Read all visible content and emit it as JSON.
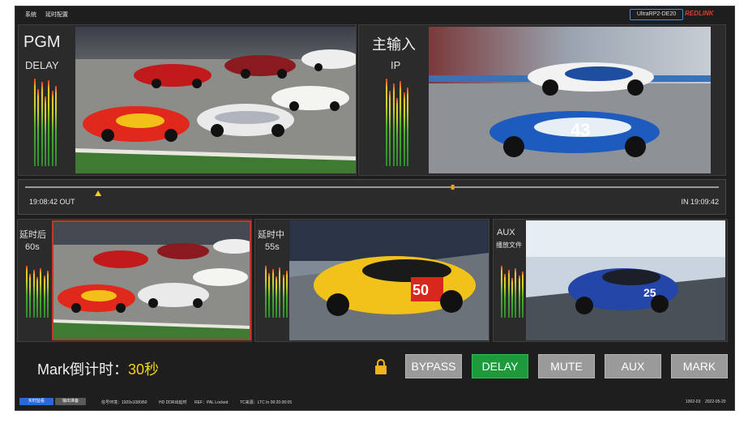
{
  "menu": {
    "system": "系统",
    "delay_config": "延时配置"
  },
  "device": {
    "model": "UltraRP2-DE20",
    "brand": "REDLINK"
  },
  "pgm": {
    "title": "PGM",
    "subtitle": "DELAY"
  },
  "input": {
    "title": "主输入",
    "subtitle": "IP"
  },
  "timeline": {
    "out_time": "19:08:42 OUT",
    "in_time": "IN 19:09:42",
    "out_marker_fraction": 0.105,
    "playhead_fraction": 0.615
  },
  "previews": [
    {
      "title": "延时后",
      "sub": "60s"
    },
    {
      "title": "延时中",
      "sub": "55s"
    },
    {
      "title": "AUX",
      "sub": "播放文件"
    }
  ],
  "mark": {
    "label": "Mark倒计时：",
    "value": "30秒"
  },
  "buttons": {
    "bypass": "BYPASS",
    "delay": "DELAY",
    "mute": "MUTE",
    "aux": "AUX",
    "mark": "MARK"
  },
  "status": {
    "tab_realtime": "实时监看",
    "tab_output": "输出准备",
    "signal": "信号环境：1920x1080i50",
    "hd": "HD DDR出延时",
    "ref": "REF：PAL Locked",
    "tc": "TC来源：LTC In 00:20:00:05",
    "code": "1002-03",
    "date": "2022-05-20"
  },
  "colors": {
    "active_button": "#1f9a3a",
    "button": "#9a9a9a",
    "mark_value": "#f2d21a",
    "accent_border": "#c0392b",
    "brand": "#e03a2e"
  }
}
